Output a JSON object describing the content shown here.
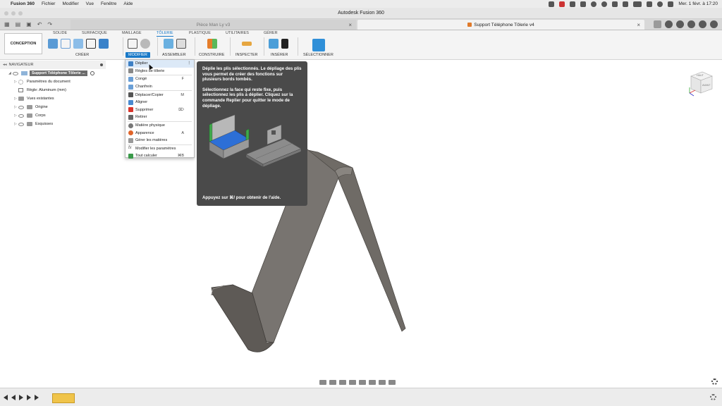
{
  "menubar": {
    "app": "Fusion 360",
    "items": [
      "Fichier",
      "Modifier",
      "Vue",
      "Fenêtre",
      "Aide"
    ],
    "datetime": "Mer. 1 févr. à 17:20"
  },
  "window": {
    "title": "Autodesk Fusion 360"
  },
  "tabs": [
    {
      "label": "Pièce Man Ly v3",
      "active": false
    },
    {
      "label": "Support Téléphone Tôlerie v4",
      "active": true
    }
  ],
  "ribbon": {
    "workspace": "CONCEPTION",
    "tabs": [
      "SOLIDE",
      "SURFACIQUE",
      "MAILLAGE",
      "TÔLERIE",
      "PLASTIQUE",
      "UTILITAIRES",
      "GÉRER"
    ],
    "active_tab": "TÔLERIE",
    "groups": [
      "CRÉER",
      "MODIFIER",
      "ASSEMBLER",
      "CONSTRUIRE",
      "INSPECTER",
      "INSÉRER",
      "SÉLECTIONNER"
    ],
    "active_group": "MODIFIER"
  },
  "navigator": {
    "title": "NAVIGATEUR",
    "root": "Support Téléphone Tôlerie ...",
    "items": [
      {
        "label": "Paramètres du document",
        "icon": "gear-icon"
      },
      {
        "label": "Règle: Aluminum (mm)",
        "icon": "rule-icon"
      },
      {
        "label": "Vues existantes",
        "icon": "folder-icon"
      },
      {
        "label": "Origine",
        "icon": "folder-icon"
      },
      {
        "label": "Corps",
        "icon": "folder-icon"
      },
      {
        "label": "Esquisses",
        "icon": "folder-icon"
      }
    ]
  },
  "dropdown": {
    "items": [
      {
        "label": "Déplier",
        "shortcut": "",
        "icon": "unfold-icon",
        "color": "#3d7fc4",
        "highlight": true
      },
      {
        "label": "Règles de tôlerie",
        "shortcut": "",
        "icon": "rules-icon",
        "color": "#888888"
      },
      {
        "label": "Congé",
        "shortcut": "F",
        "icon": "fillet-icon",
        "color": "#6a9fd6"
      },
      {
        "label": "Chanfrein",
        "shortcut": "",
        "icon": "chamfer-icon",
        "color": "#6a9fd6"
      },
      {
        "label": "Déplacer/Copier",
        "shortcut": "M",
        "icon": "move-icon",
        "color": "#555555"
      },
      {
        "label": "Aligner",
        "shortcut": "",
        "icon": "align-icon",
        "color": "#4a8ad0"
      },
      {
        "label": "Supprimer",
        "shortcut": "⌦",
        "icon": "delete-icon",
        "color": "#d9342b"
      },
      {
        "label": "Retirer",
        "shortcut": "",
        "icon": "remove-icon",
        "color": "#666666"
      },
      {
        "label": "Matière physique",
        "shortcut": "",
        "icon": "material-icon",
        "color": "#777777"
      },
      {
        "label": "Apparence",
        "shortcut": "A",
        "icon": "appearance-icon",
        "color": "#e0642a"
      },
      {
        "label": "Gérer les matières",
        "shortcut": "",
        "icon": "manage-materials-icon",
        "color": "#999999"
      },
      {
        "label": "Modifier les paramètres",
        "shortcut": "",
        "icon": "fx-icon",
        "color": "#555555"
      },
      {
        "label": "Tout calculer",
        "shortcut": "⌘B",
        "icon": "compute-icon",
        "color": "#3a9a4a"
      }
    ]
  },
  "tooltip": {
    "p1": "Déplie les plis sélectionnés. Le dépliage des plis vous permet de créer des fonctions sur plusieurs bords tombés.",
    "p2": "Sélectionnez la face qui reste fixe, puis sélectionnez les plis à déplier. Cliquez sur la commande Replier pour quitter le mode de dépliage.",
    "help": "Appuyez sur ⌘/ pour obtenir de l'aide."
  },
  "viewcube": {
    "labels": [
      "HAUT",
      "AVANT"
    ]
  },
  "colors": {
    "accent": "#1a7ac8",
    "model": "#6f6b66",
    "tooltip_bg": "#4a4a4a",
    "timeline_feature": "#f0c44a"
  }
}
